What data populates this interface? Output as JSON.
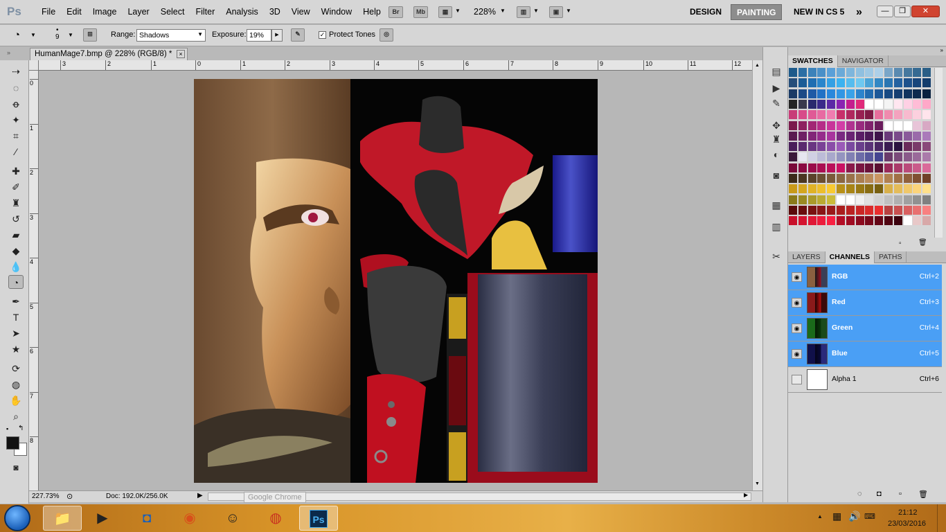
{
  "app": {
    "logo": "Ps"
  },
  "menu": [
    "File",
    "Edit",
    "Image",
    "Layer",
    "Select",
    "Filter",
    "Analysis",
    "3D",
    "View",
    "Window",
    "Help"
  ],
  "appbar": {
    "br_label": "Br",
    "mb_label": "Mb",
    "zoom": "228%"
  },
  "workspaces": {
    "design": "DESIGN",
    "painting": "PAINTING",
    "new_in_cs5": "NEW IN CS 5",
    "more": "»"
  },
  "window_controls": {
    "minimize": "—",
    "restore": "❐",
    "close": "✕"
  },
  "options": {
    "brush_size": "9",
    "range_label": "Range:",
    "range_value": "Shadows",
    "exposure_label": "Exposure:",
    "exposure_value": "19%",
    "protect_tones_label": "Protect Tones"
  },
  "document": {
    "tab_title": "HumanMage7.bmp @ 228% (RGB/8) *",
    "close": "×"
  },
  "rulers": {
    "top": [
      "3",
      "2",
      "1",
      "0",
      "1",
      "2",
      "3",
      "4",
      "5",
      "6",
      "7",
      "8",
      "9",
      "10",
      "11",
      "12"
    ],
    "left": [
      "0",
      "1",
      "2",
      "3",
      "4",
      "5",
      "6",
      "7",
      "8"
    ]
  },
  "status": {
    "zoom": "227.73%",
    "doc": "Doc: 192.0K/256.0K"
  },
  "tooltip": "Google Chrome",
  "swatches_panel": {
    "tabs": [
      "SWATCHES",
      "NAVIGATOR"
    ]
  },
  "swatch_colors": {
    "rows": [
      [
        "#1e5a8a",
        "#2c6ea4",
        "#3c82ba",
        "#4a90c8",
        "#5aa0d8",
        "#6aaad8",
        "#7eb6dc",
        "#8fc0e0",
        "#9ec8e4",
        "#aed0e8",
        "#7aa6c8",
        "#5a8ab0",
        "#46789e",
        "#366a92",
        "#2a5e86"
      ],
      [
        "#264e7a",
        "#1c5c96",
        "#1f6eb2",
        "#2a86cc",
        "#34a0e4",
        "#3cb2f0",
        "#56bcee",
        "#6ec8f0",
        "#4aa4d8",
        "#3288c4",
        "#2a76b2",
        "#2462a0",
        "#1e528c",
        "#18467c",
        "#123c6c"
      ],
      [
        "#1a3a66",
        "#1c4a86",
        "#1e5aa6",
        "#2272c6",
        "#2a88dc",
        "#3296e4",
        "#3aa2e8",
        "#2c84cc",
        "#226cb0",
        "#1c5898",
        "#184a82",
        "#143e70",
        "#10345e",
        "#0c2a4e",
        "#0a2240"
      ],
      [
        "#242424",
        "#3a3a4c",
        "#2a2a6e",
        "#3a2a8a",
        "#5c2aa6",
        "#8a24b2",
        "#c41e8e",
        "#e02a7a",
        "#ffffff",
        "#ffffff",
        "#f4f4f4",
        "#ffe6f0",
        "#ffd0e4",
        "#ffbcd6",
        "#ffa8c8"
      ],
      [
        "#c83c78",
        "#d84a8a",
        "#e05a96",
        "#e86aa2",
        "#f07cb0",
        "#c8306a",
        "#b0285e",
        "#982052",
        "#801a46",
        "#e86e9c",
        "#f08aae",
        "#f4a2be",
        "#f8bace",
        "#fcd0de",
        "#ffe4ec"
      ],
      [
        "#7a1a4c",
        "#8e2060",
        "#a22674",
        "#b62c88",
        "#c8349a",
        "#d23ea6",
        "#b03290",
        "#982a7e",
        "#80226c",
        "#6a1c5c",
        "#ffffff",
        "#ffffff",
        "#ffffff",
        "#e8c4d8",
        "#d8a8c4"
      ],
      [
        "#5a1a50",
        "#6e2064",
        "#822678",
        "#962c8c",
        "#a8349e",
        "#7a2a82",
        "#6a2474",
        "#5a1e66",
        "#4c1a58",
        "#3e144a",
        "#6a3a7a",
        "#7a4a8a",
        "#8a5a9a",
        "#9a6aaa",
        "#aa7aba"
      ],
      [
        "#4a1e5a",
        "#5a2a6e",
        "#6a3682",
        "#7a4296",
        "#8a4ea8",
        "#9a5ab8",
        "#7a4aa0",
        "#6a3e8c",
        "#5a3278",
        "#4a2664",
        "#3a1c52",
        "#2a1240",
        "#6a2a5a",
        "#7a3a6a",
        "#8a4a7a"
      ],
      [
        "#3a1a3a",
        "#e6e6f0",
        "#d0d0e4",
        "#bcbcd8",
        "#a8a8cc",
        "#9494c0",
        "#8080b4",
        "#6c6ca8",
        "#58589c",
        "#444490",
        "#6a3a6a",
        "#7a4a7a",
        "#8a5a8a",
        "#9a6a9a",
        "#aa7aaa"
      ],
      [
        "#7a0a3a",
        "#8a0a42",
        "#9a0c4a",
        "#aa0e52",
        "#ba105a",
        "#ca1262",
        "#8a1a4a",
        "#7a1642",
        "#6a123a",
        "#5a0e32",
        "#9a2a5a",
        "#aa3a6a",
        "#ba4a7a",
        "#ca5a8a",
        "#da6a9a"
      ],
      [
        "#3a2a1a",
        "#4a3622",
        "#5a422a",
        "#6a4e32",
        "#7a5a3a",
        "#8a6642",
        "#9a724a",
        "#aa7e52",
        "#ba8a5a",
        "#ca9662",
        "#b08050",
        "#a07046",
        "#90603c",
        "#805032",
        "#704028"
      ],
      [
        "#c89a1a",
        "#d4a620",
        "#e0b226",
        "#ecbe2c",
        "#f8ca32",
        "#b89018",
        "#a88416",
        "#987814",
        "#886c12",
        "#786010",
        "#d8b04a",
        "#e4bc5a",
        "#f0c86a",
        "#fcd47a",
        "#ffe08a"
      ],
      [
        "#8a7a1a",
        "#9a8a22",
        "#aa9a2a",
        "#baaa32",
        "#cabb3a",
        "#ffffff",
        "#ffffff",
        "#f0f0f0",
        "#e0e0e0",
        "#d0d0d0",
        "#c0c0c0",
        "#b0b0b0",
        "#a0a0a0",
        "#909090",
        "#808080"
      ],
      [
        "#5a0a0a",
        "#6a0e0e",
        "#7a1212",
        "#8a1616",
        "#9a1a1a",
        "#aa1e1e",
        "#ba2222",
        "#ca2626",
        "#da2a2a",
        "#ea2e2e",
        "#b84040",
        "#c85050",
        "#d86060",
        "#e87070",
        "#f88080"
      ],
      [
        "#c8102a",
        "#d41430",
        "#e01836",
        "#ec1c3c",
        "#f82042",
        "#b40e26",
        "#a00c22",
        "#8c0a1e",
        "#78081a",
        "#640616",
        "#500412",
        "#3c020e",
        "#ffffff",
        "#e8c8c8",
        "#d8a8a8"
      ]
    ]
  },
  "channels_panel": {
    "tabs": [
      "LAYERS",
      "CHANNELS",
      "PATHS"
    ],
    "rows": [
      {
        "name": "RGB",
        "shortcut": "Ctrl+2",
        "selected": true
      },
      {
        "name": "Red",
        "shortcut": "Ctrl+3",
        "selected": true
      },
      {
        "name": "Green",
        "shortcut": "Ctrl+4",
        "selected": true
      },
      {
        "name": "Blue",
        "shortcut": "Ctrl+5",
        "selected": true
      },
      {
        "name": "Alpha 1",
        "shortcut": "Ctrl+6",
        "selected": false
      }
    ]
  },
  "taskbar": {
    "ps_label": "Ps",
    "clock_time": "21:12",
    "clock_date": "23/03/2016"
  }
}
